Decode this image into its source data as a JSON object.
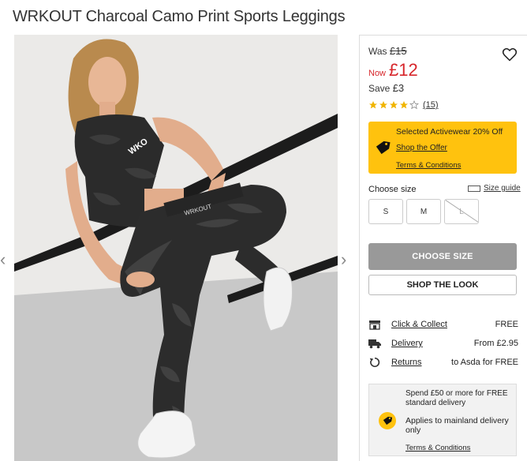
{
  "product": {
    "title": "WRKOUT Charcoal Camo Print Sports Leggings"
  },
  "price": {
    "was_label": "Was",
    "was_value": "£15",
    "now_label": "Now",
    "now_value": "£12",
    "save_label": "Save",
    "save_value": "£3"
  },
  "rating": {
    "stars": 4,
    "out_of": 5,
    "count": "(15)"
  },
  "offer": {
    "title": "Selected Activewear 20% Off",
    "shop_link": "Shop the Offer",
    "terms_link": "Terms & Conditions",
    "color": "#ffc20e"
  },
  "size": {
    "label": "Choose size",
    "guide_label": "Size guide",
    "options": [
      {
        "label": "S",
        "available": true
      },
      {
        "label": "M",
        "available": true
      },
      {
        "label": "L",
        "available": false
      }
    ]
  },
  "buttons": {
    "choose_size": "CHOOSE SIZE",
    "shop_the_look": "SHOP THE LOOK"
  },
  "delivery": {
    "rows": [
      {
        "icon": "store-icon",
        "link": "Click & Collect",
        "value": "FREE"
      },
      {
        "icon": "truck-icon",
        "link": "Delivery",
        "value": "From £2.95"
      },
      {
        "icon": "returns-icon",
        "link": "Returns",
        "value": "to Asda for FREE"
      }
    ]
  },
  "spend": {
    "headline": "Spend £50 or more for FREE standard delivery",
    "note": "Applies to mainland delivery only",
    "terms_link": "Terms & Conditions"
  },
  "image": {
    "logo_text": "WKO",
    "waistband_text": "WRKOUT"
  },
  "colors": {
    "accent_red": "#d7262b",
    "offer_yellow": "#ffc20e",
    "button_grey": "#999999"
  }
}
